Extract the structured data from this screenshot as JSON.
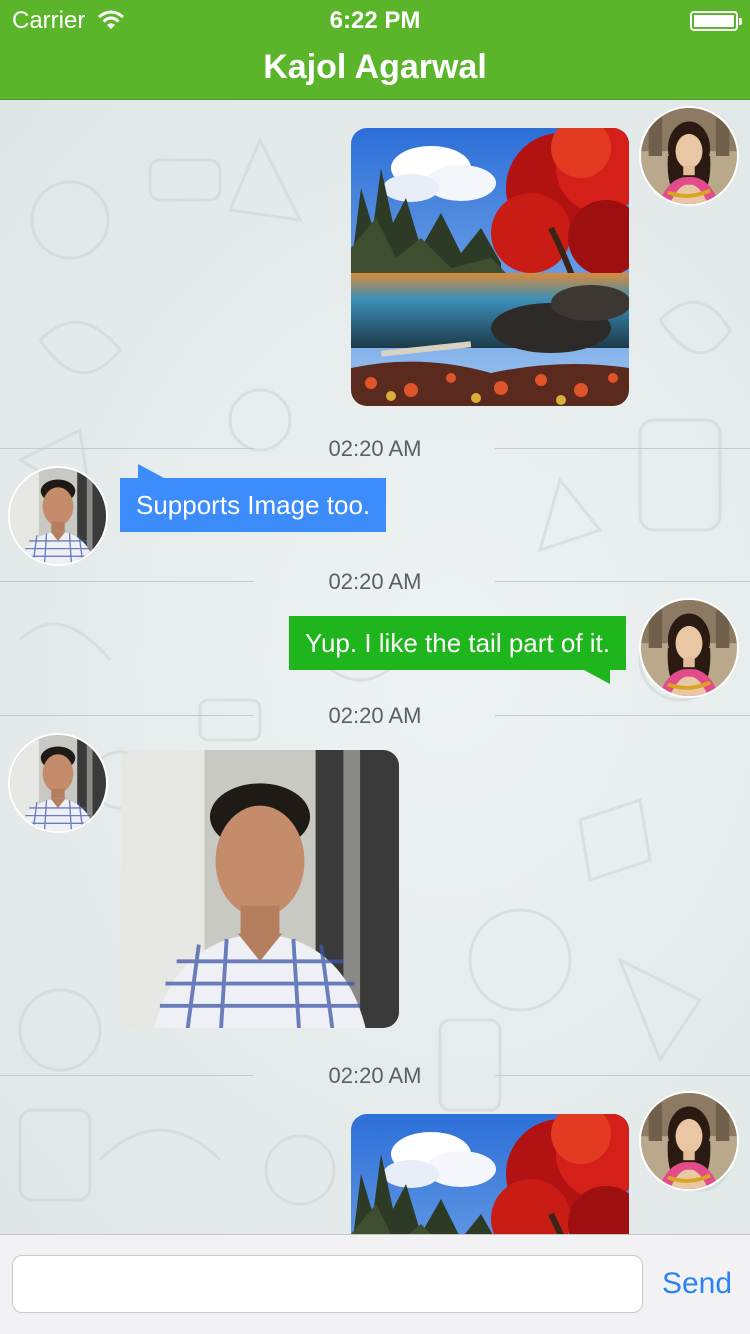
{
  "status": {
    "carrier": "Carrier",
    "time": "6:22 PM"
  },
  "header": {
    "title": "Kajol Agarwal"
  },
  "icons": {
    "wifi": "wifi-icon",
    "battery": "battery-icon"
  },
  "messages": [
    {
      "kind": "image",
      "direction": "outgoing",
      "image": "autumn-lake-photo"
    },
    {
      "kind": "timestamp",
      "text": "02:20 AM"
    },
    {
      "kind": "text",
      "direction": "incoming",
      "text": "Supports Image too."
    },
    {
      "kind": "timestamp",
      "text": "02:20 AM"
    },
    {
      "kind": "text",
      "direction": "outgoing",
      "text": "Yup. I like the tail part of it."
    },
    {
      "kind": "timestamp",
      "text": "02:20 AM"
    },
    {
      "kind": "image",
      "direction": "incoming",
      "image": "man-portrait-photo"
    },
    {
      "kind": "timestamp",
      "text": "02:20 AM"
    },
    {
      "kind": "image",
      "direction": "outgoing",
      "image": "autumn-lake-photo"
    }
  ],
  "composer": {
    "input_value": "",
    "input_placeholder": "",
    "send_label": "Send"
  },
  "colors": {
    "nav": "#5bb52a",
    "incoming_bubble": "#3d8cfb",
    "outgoing_bubble": "#1fb51c",
    "send": "#2a83ee"
  }
}
